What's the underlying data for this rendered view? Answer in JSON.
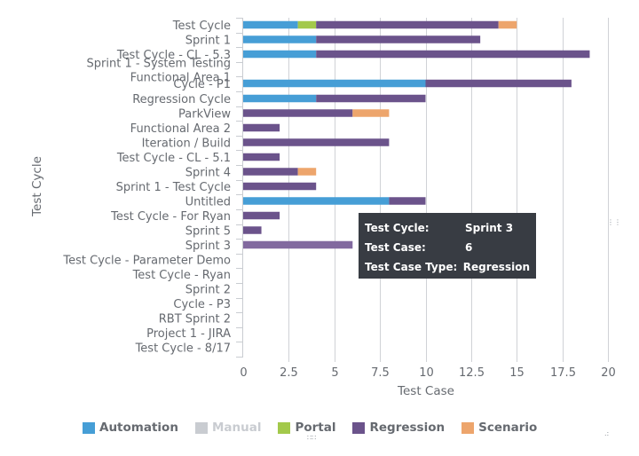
{
  "chart_data": {
    "type": "bar",
    "orientation": "horizontal",
    "stacked": true,
    "title": "",
    "xlabel": "Test Case",
    "ylabel": "Test Cycle",
    "xlim": [
      0,
      20
    ],
    "xticks": [
      "0",
      "2.5",
      "5",
      "7.5",
      "10",
      "12.5",
      "15",
      "17.5",
      "20"
    ],
    "grid": true,
    "legend_position": "bottom",
    "categories": [
      "Test Cycle",
      "Sprint 1",
      "Test Cycle - CL - 5.3",
      "Sprint 1 - System Testing",
      "Functional Area 1",
      "Cycle - P1",
      "Regression Cycle",
      "ParkView",
      "Functional Area 2",
      "Iteration / Build",
      "Test Cycle - CL - 5.1",
      "Sprint 4",
      "Sprint 1 - Test Cycle",
      "Untitled",
      "Test Cycle - For Ryan",
      "Sprint 5",
      "Sprint 3",
      "Test Cycle - Parameter Demo",
      "Test Cycle - Ryan",
      "Sprint 2",
      "Cycle - P3",
      "RBT Sprint 2",
      "Project 1 - JIRA",
      "Test Cycle - 8/17"
    ],
    "series": [
      {
        "name": "Automation",
        "color": "#469ed6",
        "visible": true,
        "values": [
          3,
          4,
          4,
          0,
          0,
          10,
          4,
          0,
          0,
          0,
          0,
          0,
          0,
          8,
          0,
          0,
          0,
          0,
          0,
          0,
          0,
          0,
          0,
          0
        ]
      },
      {
        "name": "Manual",
        "color": "#c9ccd1",
        "visible": false,
        "values": [
          0,
          0,
          0,
          0,
          0,
          0,
          0,
          0,
          0,
          0,
          0,
          0,
          0,
          0,
          0,
          0,
          0,
          0,
          0,
          0,
          0,
          0,
          0,
          0
        ]
      },
      {
        "name": "Portal",
        "color": "#a3c94b",
        "visible": true,
        "values": [
          1,
          0,
          0,
          0,
          0,
          0,
          0,
          0,
          0,
          0,
          0,
          0,
          0,
          0,
          0,
          0,
          0,
          0,
          0,
          0,
          0,
          0,
          0,
          0
        ]
      },
      {
        "name": "Regression",
        "color": "#6b538b",
        "visible": true,
        "values": [
          10,
          9,
          15,
          0,
          0,
          8,
          6,
          6,
          2,
          8,
          2,
          3,
          4,
          2,
          2,
          1,
          6,
          0,
          0,
          0,
          0,
          0,
          0,
          0
        ]
      },
      {
        "name": "Scenario",
        "color": "#eda56c",
        "visible": true,
        "values": [
          1,
          0,
          0,
          0,
          0,
          0,
          0,
          2,
          0,
          0,
          0,
          1,
          0,
          0,
          0,
          0,
          0,
          0,
          0,
          0,
          0,
          0,
          0,
          0
        ]
      }
    ],
    "highlighted": {
      "category": "Sprint 3",
      "series": "Regression",
      "color": "#82699f"
    }
  },
  "tooltip": {
    "rows": [
      {
        "key": "Test Cycle:",
        "value": "Sprint 3"
      },
      {
        "key": "Test Case:",
        "value": "6"
      },
      {
        "key": "Test Case Type:",
        "value": "Regression"
      }
    ]
  },
  "legend": {
    "items": [
      {
        "label": "Automation",
        "color": "#469ed6"
      },
      {
        "label": "Manual",
        "color": "#c9ccd1"
      },
      {
        "label": "Portal",
        "color": "#a3c94b"
      },
      {
        "label": "Regression",
        "color": "#6b538b"
      },
      {
        "label": "Scenario",
        "color": "#eda56c"
      }
    ]
  }
}
